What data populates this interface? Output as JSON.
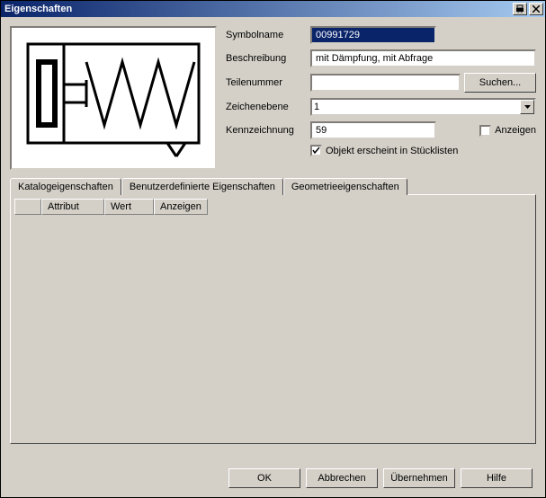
{
  "window": {
    "title": "Eigenschaften"
  },
  "fields": {
    "symbolname": {
      "label": "Symbolname",
      "value": "00991729"
    },
    "beschreibung": {
      "label": "Beschreibung",
      "value": "mit Dämpfung, mit Abfrage"
    },
    "teilenummer": {
      "label": "Teilenummer",
      "value": ""
    },
    "suchen": {
      "label": "Suchen..."
    },
    "zeichenebene": {
      "label": "Zeichenebene",
      "value": "1"
    },
    "kennzeichnung": {
      "label": "Kennzeichnung",
      "value": "59"
    },
    "anzeigen": {
      "label": "Anzeigen",
      "checked": false
    },
    "stuecklisten": {
      "label": "Objekt erscheint in Stücklisten",
      "checked": true
    }
  },
  "tabs": {
    "katalog": "Katalogeigenschaften",
    "benutzer": "Benutzerdefinierte Eigenschaften",
    "geometrie": "Geometrieeigenschaften"
  },
  "table": {
    "col_blank": "",
    "col_attribut": "Attribut",
    "col_wert": "Wert",
    "col_anzeigen": "Anzeigen"
  },
  "buttons": {
    "ok": "OK",
    "abbrechen": "Abbrechen",
    "uebernehmen": "Übernehmen",
    "hilfe": "Hilfe"
  }
}
